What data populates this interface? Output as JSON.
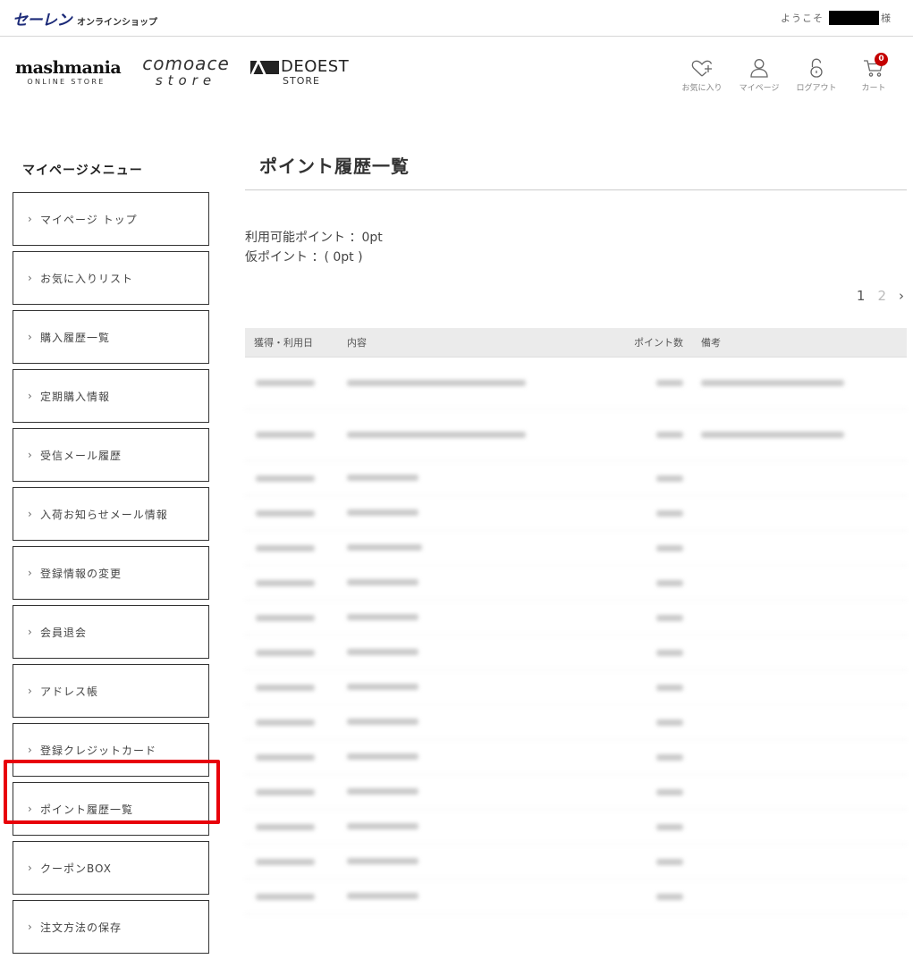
{
  "header": {
    "brand_main": "セーレン",
    "brand_sub": "オンラインショップ",
    "welcome_prefix": "ようこそ",
    "welcome_suffix": "様"
  },
  "stores": {
    "mash_main": "mashmania",
    "mash_sub": "ONLINE STORE",
    "como_main": "comoace",
    "como_sub": "store",
    "deoest_main": "DEOEST",
    "deoest_sub": "STORE"
  },
  "header_icons": {
    "favorite": {
      "label": "お気に入り",
      "icon": "heart-plus-icon"
    },
    "mypage": {
      "label": "マイページ",
      "icon": "user-icon"
    },
    "logout": {
      "label": "ログアウト",
      "icon": "unlock-icon"
    },
    "cart": {
      "label": "カート",
      "icon": "cart-icon",
      "badge": "0"
    }
  },
  "colors": {
    "brand": "#1b2a78",
    "highlight": "#e8000b",
    "badge": "#c40000"
  },
  "sidebar": {
    "title": "マイページメニュー",
    "items": [
      {
        "label": "マイページ トップ"
      },
      {
        "label": "お気に入りリスト"
      },
      {
        "label": "購入履歴一覧"
      },
      {
        "label": "定期購入情報"
      },
      {
        "label": "受信メール履歴"
      },
      {
        "label": "入荷お知らせメール情報"
      },
      {
        "label": "登録情報の変更"
      },
      {
        "label": "会員退会"
      },
      {
        "label": "アドレス帳"
      },
      {
        "label": "登録クレジットカード"
      },
      {
        "label": "ポイント履歴一覧"
      },
      {
        "label": "クーポンBOX"
      },
      {
        "label": "注文方法の保存"
      }
    ]
  },
  "main": {
    "title": "ポイント履歴一覧",
    "available_points": "利用可能ポイント ：0pt",
    "provisional_points": "仮ポイント ：( 0pt )",
    "pager": {
      "page1": "1",
      "page2": "2",
      "next": "›"
    },
    "table": {
      "headers": {
        "date": "獲得・利用日",
        "content": "内容",
        "points": "ポイント数",
        "note": "備考"
      }
    }
  }
}
